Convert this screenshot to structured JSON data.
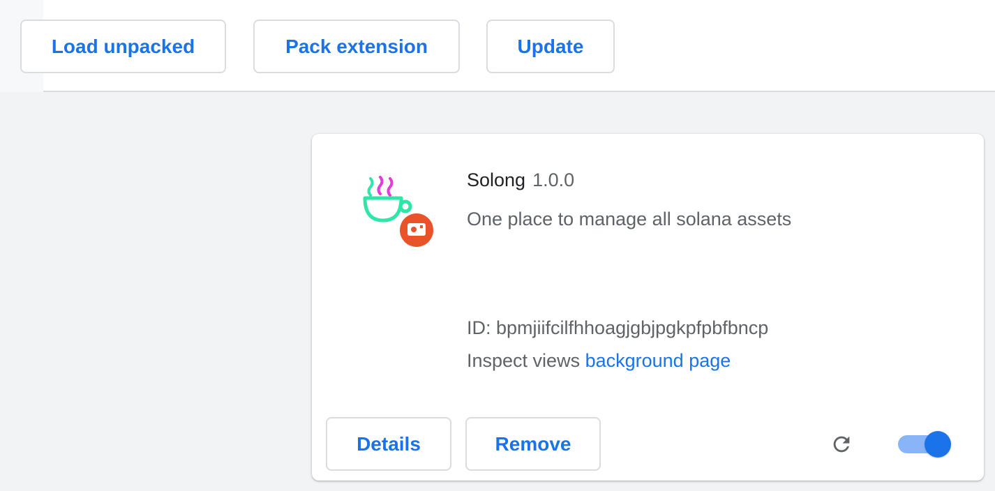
{
  "toolbar": {
    "load_unpacked_label": "Load unpacked",
    "pack_extension_label": "Pack extension",
    "update_label": "Update"
  },
  "extension": {
    "name": "Solong",
    "version": "1.0.0",
    "description": "One place to manage all solana assets",
    "id_text": "ID: bpmjiifcilfhhoagjgbjpgkpfpbfbncp",
    "inspect_label": "Inspect views",
    "inspect_link": "background page",
    "details_label": "Details",
    "remove_label": "Remove",
    "enabled": true,
    "icon": "solong-cup-icon",
    "badge_icon": "unpacked-badge-icon",
    "reload_icon": "reload-icon"
  },
  "colors": {
    "accent": "#1a73e8",
    "toggle_track": "#8ab4f8",
    "badge": "#e8532a",
    "icon_green": "#2ee6a8",
    "icon_magenta": "#e33ad9"
  }
}
